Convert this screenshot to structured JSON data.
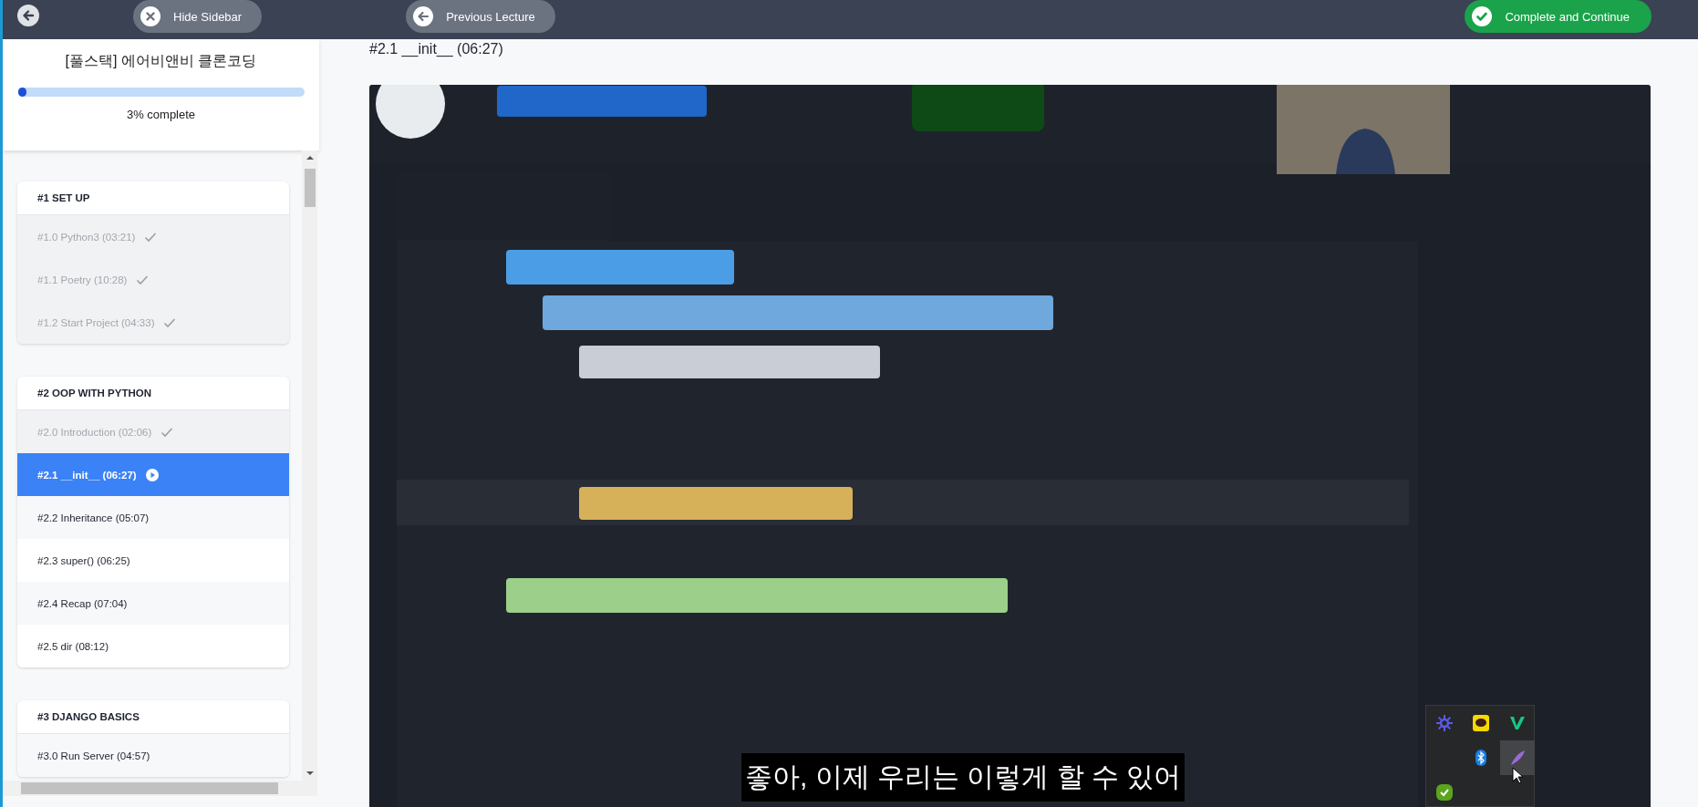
{
  "header": {
    "hide_sidebar": "Hide Sidebar",
    "previous_lecture": "Previous Lecture",
    "complete_button": "Complete and Continue"
  },
  "sidebar": {
    "course_title": "[풀스택] 에어비앤비 클론코딩",
    "progress": {
      "level": 0.03,
      "label": "3% complete"
    },
    "sections": [
      {
        "title": "#1 SET UP",
        "lectures": [
          {
            "label": "#1.0 Python3 (03:21)",
            "completed": true,
            "selected": false
          },
          {
            "label": "#1.1 Poetry (10:28)",
            "completed": true,
            "selected": false
          },
          {
            "label": "#1.2 Start Project (04:33)",
            "completed": true,
            "selected": false
          }
        ]
      },
      {
        "title": "#2 OOP WITH PYTHON",
        "lectures": [
          {
            "label": "#2.0 Introduction (02:06)",
            "completed": true,
            "selected": false
          },
          {
            "label": "#2.1 __init__ (06:27)",
            "completed": false,
            "selected": true
          },
          {
            "label": "#2.2 Inheritance (05:07)",
            "completed": false,
            "selected": false
          },
          {
            "label": "#2.3 super() (06:25)",
            "completed": false,
            "selected": false
          },
          {
            "label": "#2.4 Recap (07:04)",
            "completed": false,
            "selected": false
          },
          {
            "label": "#2.5 dir (08:12)",
            "completed": false,
            "selected": false
          }
        ]
      },
      {
        "title": "#3 DJANGO BASICS",
        "lectures": [
          {
            "label": "#3.0 Run Server (04:57)",
            "completed": false,
            "selected": false
          }
        ]
      }
    ]
  },
  "lecture_title": "#2.1 __init__ (06:27)",
  "video": {
    "kind": "picture",
    "subtitle": "좋아, 이제 우리는 이렇게 할 수 있어"
  }
}
